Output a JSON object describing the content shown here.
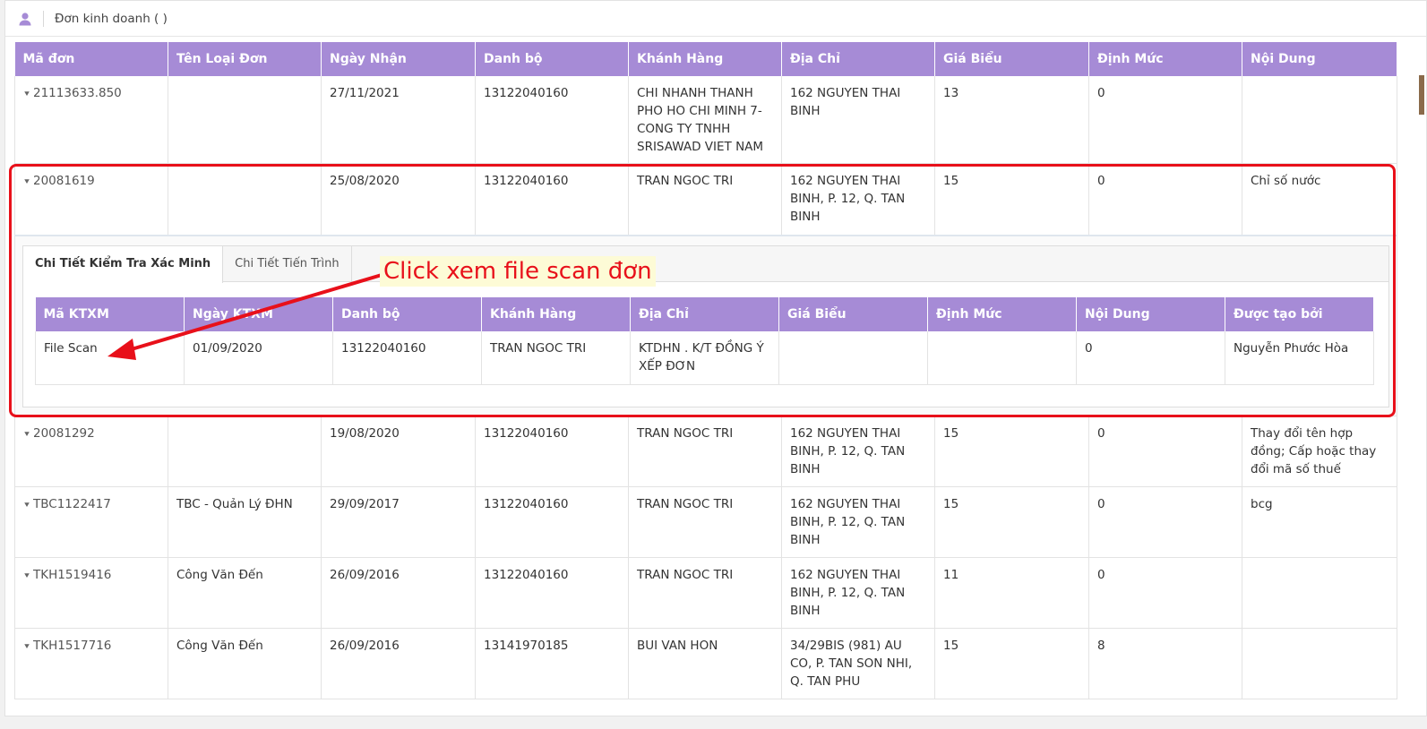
{
  "header": {
    "title": "Đơn kinh doanh ( )",
    "icon": "user-icon"
  },
  "main_table": {
    "columns": [
      "Mã đơn",
      "Tên Loại Đơn",
      "Ngày Nhận",
      "Danh bộ",
      "Khánh Hàng",
      "Địa Chỉ",
      "Giá Biểu",
      "Định Mức",
      "Nội Dung"
    ],
    "rows": [
      {
        "ma_don": "21113633.850",
        "ten_loai": "",
        "ngay_nhan": "27/11/2021",
        "danh_bo": "13122040160",
        "khach_hang": "CHI NHANH THANH PHO HO CHI MINH 7- CONG TY TNHH SRISAWAD VIET NAM",
        "dia_chi": "162 NGUYEN THAI BINH",
        "gia_bieu": "13",
        "dinh_muc": "0",
        "noi_dung": ""
      },
      {
        "ma_don": "20081619",
        "ten_loai": "",
        "ngay_nhan": "25/08/2020",
        "danh_bo": "13122040160",
        "khach_hang": "TRAN NGOC TRI",
        "dia_chi": "162 NGUYEN THAI BINH, P. 12, Q. TAN BINH",
        "gia_bieu": "15",
        "dinh_muc": "0",
        "noi_dung": "Chỉ số nước"
      },
      {
        "ma_don": "20081292",
        "ten_loai": "",
        "ngay_nhan": "19/08/2020",
        "danh_bo": "13122040160",
        "khach_hang": "TRAN NGOC TRI",
        "dia_chi": "162 NGUYEN THAI BINH, P. 12, Q. TAN BINH",
        "gia_bieu": "15",
        "dinh_muc": "0",
        "noi_dung": "Thay đổi tên hợp đồng; Cấp hoặc thay đổi mã số thuế"
      },
      {
        "ma_don": "TBC1122417",
        "ten_loai": "TBC - Quản Lý ĐHN",
        "ngay_nhan": "29/09/2017",
        "danh_bo": "13122040160",
        "khach_hang": "TRAN NGOC TRI",
        "dia_chi": "162 NGUYEN THAI BINH, P. 12, Q. TAN BINH",
        "gia_bieu": "15",
        "dinh_muc": "0",
        "noi_dung": "bcg"
      },
      {
        "ma_don": "TKH1519416",
        "ten_loai": "Công Văn Đến",
        "ngay_nhan": "26/09/2016",
        "danh_bo": "13122040160",
        "khach_hang": "TRAN NGOC TRI",
        "dia_chi": "162 NGUYEN THAI BINH, P. 12, Q. TAN BINH",
        "gia_bieu": "11",
        "dinh_muc": "0",
        "noi_dung": ""
      },
      {
        "ma_don": "TKH1517716",
        "ten_loai": "Công Văn Đến",
        "ngay_nhan": "26/09/2016",
        "danh_bo": "13141970185",
        "khach_hang": "BUI VAN HON",
        "dia_chi": "34/29BIS (981) AU CO, P. TAN SON NHI, Q. TAN PHU",
        "gia_bieu": "15",
        "dinh_muc": "8",
        "noi_dung": ""
      }
    ]
  },
  "detail": {
    "tabs": [
      "Chi Tiết Kiểm Tra Xác Minh",
      "Chi Tiết Tiến Trình"
    ],
    "active_tab": 0,
    "columns": [
      "Mã KTXM",
      "Ngày KTXM",
      "Danh bộ",
      "Khánh Hàng",
      "Địa Chỉ",
      "Giá Biểu",
      "Định Mức",
      "Nội Dung",
      "Được tạo bởi"
    ],
    "row": {
      "ma_ktxm": "File Scan",
      "ngay_ktxm": "01/09/2020",
      "danh_bo": "13122040160",
      "khach_hang": "TRAN NGOC TRI",
      "dia_chi": "KTDHN . K/T ĐỒNG Ý XẾP ĐƠN",
      "gia_bieu": "",
      "dinh_muc": "",
      "noi_dung": "0",
      "tao_boi": "Nguyễn Phước Hòa"
    }
  },
  "annotation": {
    "text": "Click xem file scan đơn",
    "color": "#e8101a"
  },
  "colors": {
    "header_bg": "#a68bd6",
    "highlight": "#e8101a"
  }
}
